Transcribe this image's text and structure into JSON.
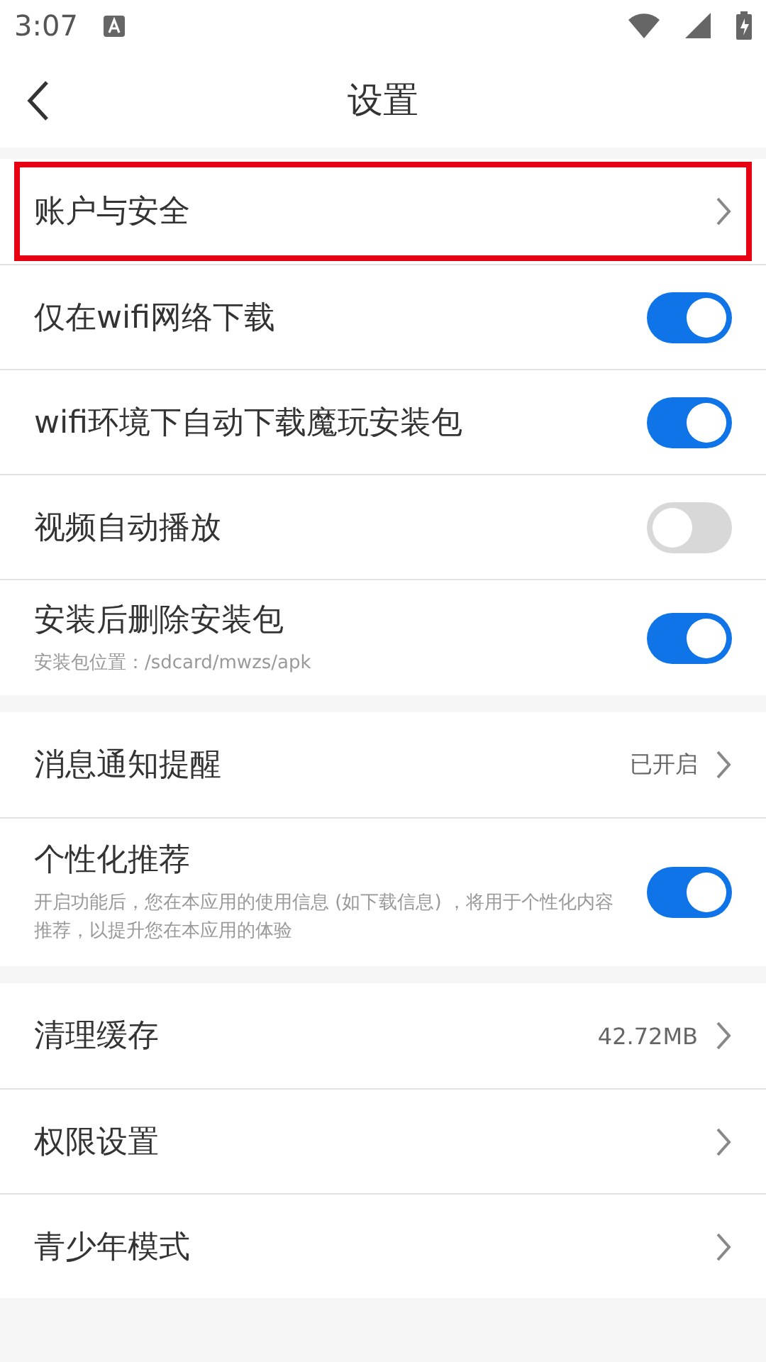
{
  "status_bar": {
    "time": "3:07"
  },
  "header": {
    "title": "设置"
  },
  "groups": [
    {
      "items": [
        {
          "kind": "link",
          "label": "账户与安全",
          "highlighted": true
        },
        {
          "kind": "toggle",
          "label": "仅在wifi网络下载",
          "on": true
        },
        {
          "kind": "toggle",
          "label": "wifi环境下自动下载魔玩安装包",
          "on": true
        },
        {
          "kind": "toggle",
          "label": "视频自动播放",
          "on": false
        },
        {
          "kind": "toggle",
          "label": "安装后删除安装包",
          "subtitle": "安装包位置：/sdcard/mwzs/apk",
          "on": true
        }
      ]
    },
    {
      "items": [
        {
          "kind": "link",
          "label": "消息通知提醒",
          "value": "已开启"
        },
        {
          "kind": "toggle",
          "label": "个性化推荐",
          "subtitle": "开启功能后，您在本应用的使用信息 (如下载信息) ，将用于个性化内容推荐，以提升您在本应用的体验",
          "on": true
        }
      ]
    },
    {
      "items": [
        {
          "kind": "link",
          "label": "清理缓存",
          "value": "42.72MB"
        },
        {
          "kind": "link",
          "label": "权限设置"
        },
        {
          "kind": "link",
          "label": "青少年模式"
        }
      ]
    }
  ]
}
